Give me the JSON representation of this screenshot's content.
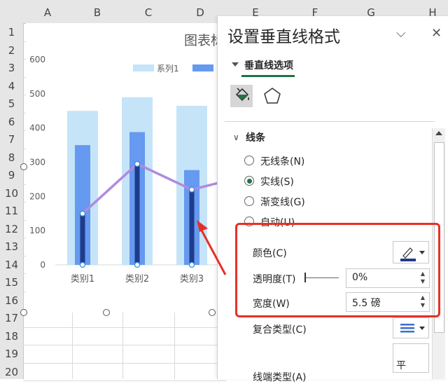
{
  "sheet": {
    "columns": [
      "A",
      "B",
      "C",
      "D",
      "E",
      "F",
      "G",
      "H"
    ],
    "rows": [
      "1",
      "2",
      "3",
      "4",
      "5",
      "6",
      "7",
      "8",
      "9",
      "10",
      "11",
      "12",
      "13",
      "14",
      "15",
      "16",
      "17",
      "18",
      "19",
      "20"
    ]
  },
  "chart": {
    "title_partial": "图表标",
    "legend_series1": "系列1"
  },
  "chart_data": {
    "type": "bar",
    "categories": [
      "类别1",
      "类别2",
      "类别3"
    ],
    "yticks": [
      "0",
      "100",
      "200",
      "300",
      "400",
      "500",
      "600"
    ],
    "ylim": [
      0,
      600
    ],
    "series": [
      {
        "name": "系列1",
        "kind": "bar-wide",
        "values": [
          450,
          490,
          465
        ],
        "color": "#c5e4f8"
      },
      {
        "kind": "bar-narrow",
        "values": [
          350,
          388,
          277
        ],
        "color": "#6699f0"
      },
      {
        "kind": "drop-line",
        "values": [
          150,
          295,
          220
        ],
        "color": "#1f3b8c"
      },
      {
        "kind": "line",
        "values": [
          150,
          295,
          220
        ],
        "color": "#b08ae0"
      }
    ],
    "legend": "top-right"
  },
  "panel": {
    "title": "设置垂直线格式",
    "tab_label": "垂直线选项",
    "section": "线条",
    "radios": [
      {
        "label": "无线条(N)",
        "checked": false
      },
      {
        "label": "实线(S)",
        "checked": true
      },
      {
        "label": "渐变线(G)",
        "checked": false
      },
      {
        "label": "自动(U)",
        "checked": false
      }
    ],
    "color_label": "颜色(C)",
    "transparency_label": "透明度(T)",
    "transparency_value": "0%",
    "width_label": "宽度(W)",
    "width_value": "5.5 磅",
    "compound_label": "复合类型(C)",
    "cut_label": "线端类型(A)",
    "cut_value_partial": "平",
    "accent": "#217346",
    "highlight": "#e63027"
  }
}
